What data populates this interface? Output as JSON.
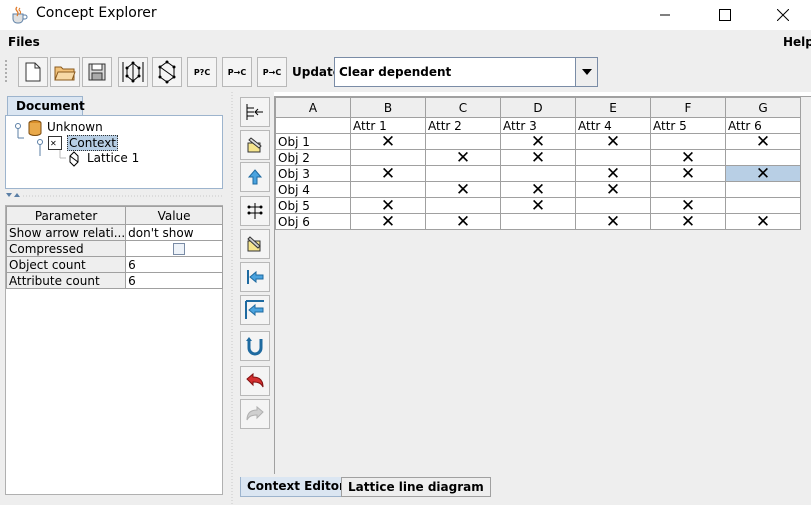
{
  "window": {
    "title": "Concept Explorer",
    "icon": "java-cup-icon",
    "controls": [
      "minimize-icon",
      "maximize-icon",
      "close-icon"
    ]
  },
  "menubar": {
    "files": "Files",
    "help": "Help"
  },
  "toolbar": {
    "buttons": [
      {
        "icon": "new-document-icon",
        "label": ""
      },
      {
        "icon": "open-folder-icon",
        "label": ""
      },
      {
        "icon": "save-disk-icon",
        "label": ""
      },
      {
        "icon": "lattice-build-icon",
        "label": ""
      },
      {
        "icon": "lattice-icon",
        "label": ""
      },
      {
        "icon": "implications-icon",
        "label": "P?C"
      },
      {
        "icon": "rules-icon",
        "label": "P→C"
      },
      {
        "icon": "association-rules-icon",
        "label": "P→C"
      }
    ],
    "update_label": "Update:",
    "update_value": "Clear dependent"
  },
  "document_panel": {
    "tab_label": "Document",
    "tree": [
      {
        "label": "Unknown",
        "icon": "database-icon"
      },
      {
        "label": "Context",
        "icon": "context-icon",
        "selected": true
      },
      {
        "label": "Lattice 1",
        "icon": "lattice-icon"
      }
    ]
  },
  "params": {
    "headers": [
      "Parameter",
      "Value"
    ],
    "rows": [
      {
        "name": "Show arrow relati...",
        "value": "don't show"
      },
      {
        "name": "Compressed",
        "value": ""
      },
      {
        "name": "Object count",
        "value": "6"
      },
      {
        "name": "Attribute count",
        "value": "6"
      }
    ],
    "compressed_checked": false
  },
  "side_toolbar": {
    "icons": [
      "add-attribute-icon",
      "edit-object-icon",
      "move-up-icon",
      "reduce-context-icon",
      "edit-attribute-icon",
      "move-left-icon",
      "move-up-left-icon",
      "transpose-icon",
      "undo-icon",
      "redo-icon"
    ]
  },
  "context": {
    "col_letters": [
      "A",
      "B",
      "C",
      "D",
      "E",
      "F",
      "G"
    ],
    "attributes": [
      "",
      "Attr 1",
      "Attr 2",
      "Attr 3",
      "Attr 4",
      "Attr 5",
      "Attr 6"
    ],
    "objects": [
      "Obj 1",
      "Obj 2",
      "Obj 3",
      "Obj 4",
      "Obj 5",
      "Obj 6"
    ],
    "cross_symbol": "✕",
    "incidence": [
      [
        1,
        0,
        1,
        1,
        0,
        1
      ],
      [
        0,
        1,
        1,
        0,
        1,
        0
      ],
      [
        1,
        0,
        0,
        1,
        1,
        1
      ],
      [
        0,
        1,
        1,
        1,
        0,
        0
      ],
      [
        1,
        0,
        1,
        0,
        1,
        0
      ],
      [
        1,
        1,
        0,
        1,
        1,
        1
      ]
    ],
    "selected_cell": {
      "row": 2,
      "col": 5
    }
  },
  "bottom_tabs": {
    "context_editor": "Context Editor",
    "lattice_line_diagram": "Lattice line diagram"
  }
}
